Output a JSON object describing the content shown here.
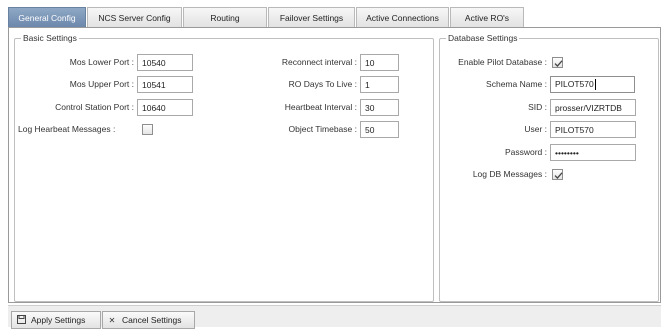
{
  "tabs": [
    {
      "label": "General Config",
      "active": true
    },
    {
      "label": "NCS Server Config",
      "active": false
    },
    {
      "label": "Routing",
      "active": false
    },
    {
      "label": "Failover Settings",
      "active": false
    },
    {
      "label": "Active Connections",
      "active": false
    },
    {
      "label": "Active RO's",
      "active": false
    }
  ],
  "basic_settings": {
    "title": "Basic Settings",
    "mos_lower_port": {
      "label": "Mos Lower Port :",
      "value": "10540"
    },
    "mos_upper_port": {
      "label": "Mos Upper Port :",
      "value": "10541"
    },
    "control_station_port": {
      "label": "Control Station Port :",
      "value": "10640"
    },
    "log_heartbeat_messages": {
      "label": "Log Hearbeat Messages :",
      "checked": false
    },
    "reconnect_interval": {
      "label": "Reconnect interval :",
      "value": "10"
    },
    "ro_days_to_live": {
      "label": "RO Days To Live :",
      "value": "1"
    },
    "heartbeat_interval": {
      "label": "Heartbeat Interval :",
      "value": "30"
    },
    "object_timebase": {
      "label": "Object Timebase :",
      "value": "50"
    }
  },
  "database_settings": {
    "title": "Database Settings",
    "enable_pilot_database": {
      "label": "Enable Pilot Database :",
      "checked": true
    },
    "schema_name": {
      "label": "Schema Name :",
      "value": "PILOT570"
    },
    "sid": {
      "label": "SID :",
      "value": "prosser/VIZRTDB"
    },
    "user": {
      "label": "User :",
      "value": "PILOT570"
    },
    "password": {
      "label": "Password :",
      "value": "••••••••"
    },
    "log_db_messages": {
      "label": "Log DB Messages :",
      "checked": true
    }
  },
  "actions": {
    "apply_label": "Apply Settings",
    "apply_icon": "save-icon",
    "cancel_label": "Cancel Settings",
    "cancel_icon": "close-icon"
  },
  "colors": {
    "active_tab": "#7a93b5",
    "border": "#9a9a9a"
  }
}
